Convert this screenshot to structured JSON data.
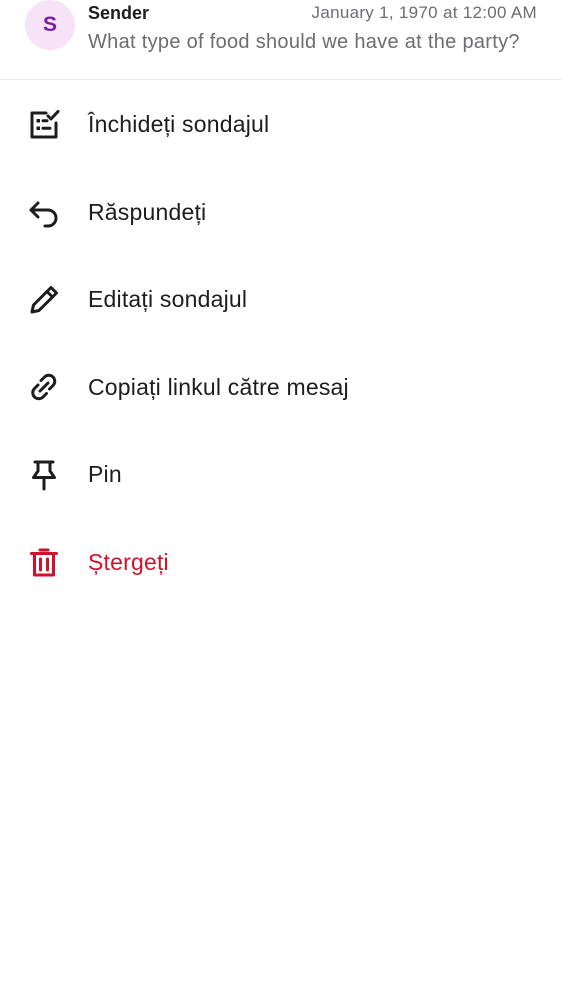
{
  "header": {
    "avatar_letter": "S",
    "sender": "Sender",
    "timestamp": "January 1, 1970 at 12:00 AM",
    "preview": "What type of food should we have at the party?"
  },
  "menu": {
    "items": [
      {
        "label": "Închideți sondajul",
        "icon": "poll-close-icon"
      },
      {
        "label": "Răspundeți",
        "icon": "reply-icon"
      },
      {
        "label": "Editați sondajul",
        "icon": "pencil-icon"
      },
      {
        "label": "Copiați linkul către mesaj",
        "icon": "link-icon"
      },
      {
        "label": "Pin",
        "icon": "pin-icon"
      },
      {
        "label": "Ștergeți",
        "icon": "trash-icon"
      }
    ]
  },
  "colors": {
    "text": "#1d1d1f",
    "muted": "#6c6c72",
    "danger": "#d0112b",
    "avatar_bg": "#f6e3f7",
    "avatar_fg": "#7b1fa2"
  }
}
